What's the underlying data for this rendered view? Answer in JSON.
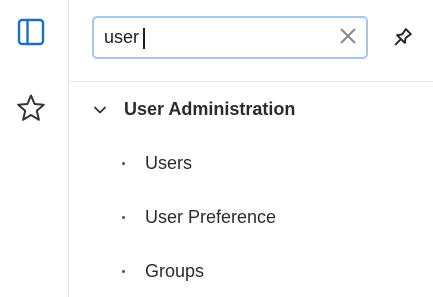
{
  "rail": {
    "items": [
      {
        "icon": "sidebar-panel-icon",
        "active": true,
        "color": "#1f6fbf"
      },
      {
        "icon": "star-icon",
        "active": false,
        "color": "#333333"
      }
    ]
  },
  "search": {
    "value": "user",
    "placeholder": "",
    "clear_icon": "close-icon",
    "focus_color": "#a9c6e8"
  },
  "pin": {
    "icon": "pin-icon"
  },
  "tree": {
    "group": {
      "label": "User Administration",
      "expanded": true,
      "icon": "chevron-down-icon"
    },
    "items": [
      {
        "label": "Users"
      },
      {
        "label": "User Preference"
      },
      {
        "label": "Groups"
      }
    ]
  }
}
